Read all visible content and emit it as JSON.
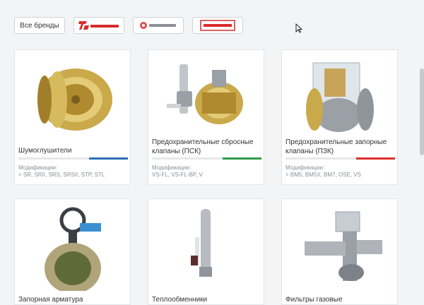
{
  "brands": {
    "all_label": "Все бренды",
    "logos": [
      {
        "name": "TARTARINI",
        "color": "#d92b2b"
      },
      {
        "name": "FRANCEL",
        "color": "#d92b2b"
      },
      {
        "name": "FISHER",
        "color": "#d92b2b"
      }
    ]
  },
  "products": [
    {
      "title": "Шумоглушители",
      "mods_label": "Модификации:",
      "mods": "> SR, SRII, SRS, SRSII, STP, STL",
      "accent": "#2d6fb6"
    },
    {
      "title": "Предохранительные сбросные клапаны (ПСК)",
      "mods_label": "Модификации:",
      "mods": "VS-FL, VS-FL-BP, V",
      "accent": "#2f9b4a"
    },
    {
      "title": "Предохранительные запорные клапаны (ПЗК)",
      "mods_label": "Модификации:",
      "mods": "> BM5, BM5X, BM7, OSE, VS",
      "accent": "#d9312e"
    },
    {
      "title": "Запорная арматура"
    },
    {
      "title": "Теплообменники"
    },
    {
      "title": "Фильтры газовые"
    }
  ],
  "colors": {
    "background": "#f3f4f5",
    "card": "#ffffff",
    "brass": "#c9a94a",
    "steel": "#8f959b"
  }
}
